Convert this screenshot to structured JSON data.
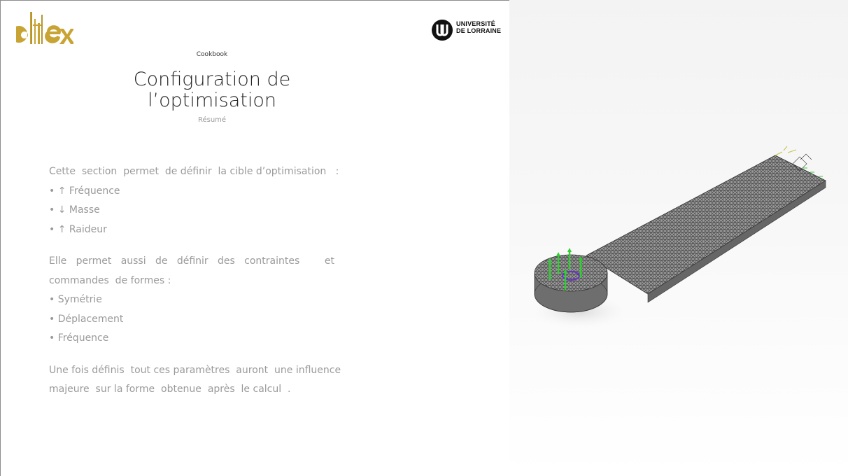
{
  "header": {
    "left_logo_text": "ditex",
    "right_logo_text": [
      "UNIVERSITÉ",
      "DE LORRAINE"
    ]
  },
  "slide": {
    "kicker": "Cookbook",
    "title_line1": "Configuration de",
    "title_line2": "l’optimisation",
    "subtitle": "Résumé",
    "intro": "Cette  section  permet  de définir  la cible d’optimisation   :",
    "targets": [
      "• ↑ Fréquence",
      "• ↓ Masse",
      "• ↑ Raideur"
    ],
    "constraints_intro_line1": "Elle   permet   aussi   de   définir   des   contraintes        et",
    "constraints_intro_line2": "commandes  de formes :",
    "constraints": [
      "• Symétrie",
      "• Déplacement",
      "• Fréquence"
    ],
    "conclusion_line1": "Une fois définis  tout ces paramètres  auront  une influence",
    "conclusion_line2": "majeure  sur la forme  obtenue  après  le calcul  ."
  },
  "colors": {
    "logo_gold": "#c8a434",
    "mesh_dark": "#555555",
    "load_green": "#2fd12f",
    "load_purple": "#6a2ec9"
  },
  "icons": {
    "model": "fea-mesh-wrench-model"
  }
}
